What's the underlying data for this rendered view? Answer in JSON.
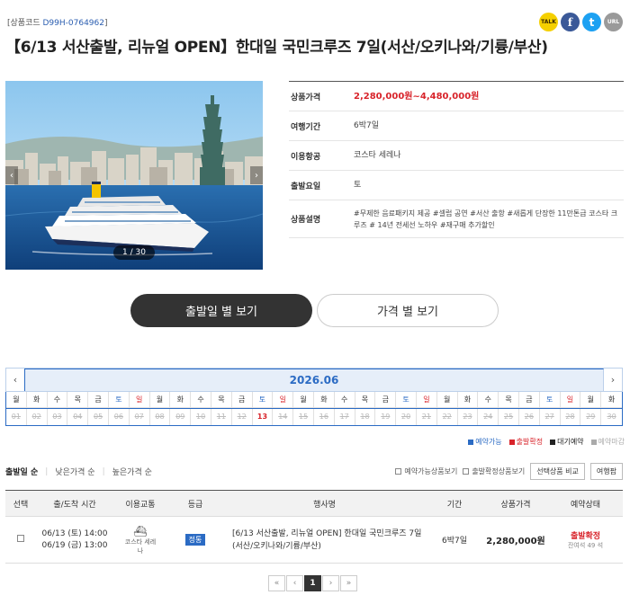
{
  "header": {
    "code_label": "[상품코드 ",
    "code_value": "D99H-0764962",
    "code_end": "]",
    "title": "【6/13 서산출발, 리뉴얼 OPEN】한대일 국민크루즈 7일(서산/오키나와/기륭/부산)"
  },
  "social": {
    "talk": "TALK",
    "facebook": "f",
    "twitter": "t",
    "url": "URL"
  },
  "gallery": {
    "counter": "1 / 30",
    "prev": "‹",
    "next": "›"
  },
  "info": {
    "price_label": "상품가격",
    "price_value": "2,280,000원~4,480,000원",
    "period_label": "여행기간",
    "period_value": "6박7일",
    "carrier_label": "이용항공",
    "carrier_value": "코스타 세레나",
    "depday_label": "출발요일",
    "depday_value": "토",
    "desc_label": "상품설명",
    "desc_value": "#무제한 음료패키지 제공 #셀럽 공연 #서산 출항 #새롭게 단장한 11만톤급 코스타 크루즈 # 14년 전세선 노하우 #재구매 추가할인"
  },
  "buttons": {
    "by_departure": "출발일 별 보기",
    "by_price": "가격 별 보기"
  },
  "calendar": {
    "prev": "‹",
    "next": "›",
    "month": "2026.06",
    "weekdays": [
      "월",
      "화",
      "수",
      "목",
      "금",
      "토",
      "일",
      "월",
      "화",
      "수",
      "목",
      "금",
      "토",
      "일",
      "월",
      "화",
      "수",
      "목",
      "금",
      "토",
      "일",
      "월",
      "화",
      "수",
      "목",
      "금",
      "토",
      "일",
      "월",
      "화"
    ],
    "dates": [
      "01",
      "02",
      "03",
      "04",
      "05",
      "06",
      "07",
      "08",
      "09",
      "10",
      "11",
      "12",
      "13",
      "14",
      "15",
      "16",
      "17",
      "18",
      "19",
      "20",
      "21",
      "22",
      "23",
      "24",
      "25",
      "26",
      "27",
      "28",
      "29",
      "30"
    ],
    "active_date": "13"
  },
  "legend": {
    "available": "예약가능",
    "confirmed": "출발확정",
    "waiting": "대기예약",
    "closed": "예약마감",
    "colors": {
      "available": "#2b6bc4",
      "confirmed": "#d8232a",
      "waiting": "#222222",
      "closed": "#aaaaaa"
    }
  },
  "sort": {
    "by_departure": "출발일 순",
    "by_low_price": "낮은가격 순",
    "by_high_price": "높은가격 순",
    "filter_available": "예약가능상품보기",
    "filter_confirmed": "출발확정상품보기",
    "compare": "선택상품 비교",
    "schedule": "여행팜"
  },
  "table": {
    "headers": [
      "선택",
      "출/도착 시간",
      "이용교통",
      "등급",
      "행사명",
      "기간",
      "상품가격",
      "예약상태"
    ],
    "row": {
      "depart": "06/13 (토) 14:00",
      "arrive": "06/19 (금) 13:00",
      "ship_line1": "코스타 세레",
      "ship_line2": "나",
      "grade": "정통",
      "name": "[6/13 서산출발, 리뉴얼 OPEN] 한대일 국민크루즈 7일(서산/오키나와/기륭/부산)",
      "period": "6박7일",
      "price": "2,280,000원",
      "status": "출발확정",
      "seats": "잔여석 49 석"
    }
  },
  "pager": {
    "first": "«",
    "prev": "‹",
    "current": "1",
    "next": "›",
    "last": "»"
  }
}
